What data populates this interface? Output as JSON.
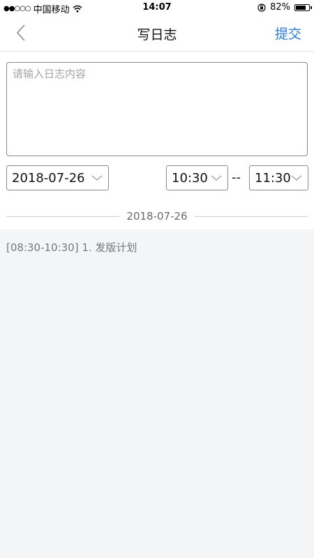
{
  "status_bar": {
    "signal": "●●○○○",
    "carrier": "中国移动",
    "time": "14:07",
    "battery": "82%",
    "battery_level": 0.82
  },
  "nav": {
    "title": "写日志",
    "submit_label": "提交"
  },
  "form": {
    "content_placeholder": "请输入日志内容",
    "date_value": "2018-07-26",
    "start_time": "10:30",
    "range_separator": "--",
    "end_time": "11:30"
  },
  "log": {
    "date_header": "2018-07-26",
    "entries": [
      {
        "text": "[08:30-10:30] 1. 发版计划"
      }
    ]
  },
  "colors": {
    "accent": "#2e7ad6",
    "background": "#f4f5f7"
  }
}
